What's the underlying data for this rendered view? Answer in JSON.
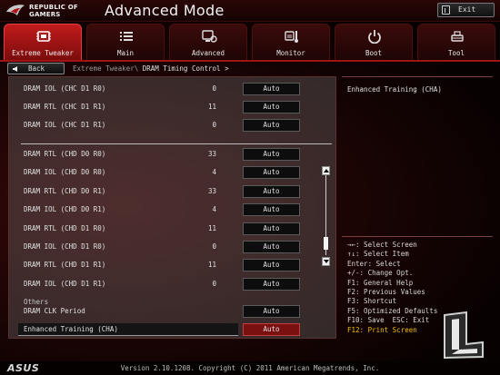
{
  "header": {
    "brand_line1": "REPUBLIC OF",
    "brand_line2": "GAMERS",
    "mode_title": "Advanced Mode",
    "exit_label": "Exit"
  },
  "tabs": [
    {
      "label": "Extreme Tweaker",
      "icon": "chip-icon",
      "active": true
    },
    {
      "label": "Main",
      "icon": "list-icon",
      "active": false
    },
    {
      "label": "Advanced",
      "icon": "advanced-icon",
      "active": false
    },
    {
      "label": "Monitor",
      "icon": "monitor-icon",
      "active": false
    },
    {
      "label": "Boot",
      "icon": "power-icon",
      "active": false
    },
    {
      "label": "Tool",
      "icon": "tool-icon",
      "active": false
    }
  ],
  "breadcrumb": {
    "back_label": "Back",
    "path_parent": "Extreme Tweaker\\",
    "path_current": " DRAM Timing Control >"
  },
  "settings_group1": [
    {
      "label": "DRAM IOL (CHC D1 R0)",
      "value": "0",
      "setting": "Auto"
    },
    {
      "label": "DRAM RTL (CHC D1 R1)",
      "value": "11",
      "setting": "Auto"
    },
    {
      "label": "DRAM IOL (CHC D1 R1)",
      "value": "0",
      "setting": "Auto"
    }
  ],
  "settings_group2": [
    {
      "label": "DRAM RTL (CHD D0 R0)",
      "value": "33",
      "setting": "Auto"
    },
    {
      "label": "DRAM IOL (CHD D0 R0)",
      "value": "4",
      "setting": "Auto"
    },
    {
      "label": "DRAM RTL (CHD D0 R1)",
      "value": "33",
      "setting": "Auto"
    },
    {
      "label": "DRAM IOL (CHD D0 R1)",
      "value": "4",
      "setting": "Auto"
    },
    {
      "label": "DRAM RTL (CHD D1 R0)",
      "value": "11",
      "setting": "Auto"
    },
    {
      "label": "DRAM IOL (CHD D1 R0)",
      "value": "0",
      "setting": "Auto"
    },
    {
      "label": "DRAM RTL (CHD D1 R1)",
      "value": "11",
      "setting": "Auto"
    },
    {
      "label": "DRAM IOL (CHD D1 R1)",
      "value": "0",
      "setting": "Auto"
    }
  ],
  "others": {
    "section_label": "Others",
    "clk_period": {
      "label": "DRAM CLK Period",
      "setting": "Auto"
    },
    "enhanced_training": {
      "label": "Enhanced Training (CHA)",
      "setting": "Auto"
    }
  },
  "help": {
    "title": "Enhanced Training (CHA)",
    "keys": [
      "→←: Select Screen",
      "↑↓: Select Item",
      "Enter: Select",
      "+/-: Change Opt.",
      "F1: General Help",
      "F2: Previous Values",
      "F3: Shortcut",
      "F5: Optimized Defaults",
      "F10: Save  ESC: Exit",
      "F12: Print Screen"
    ]
  },
  "footer": {
    "brand": "ASUS",
    "version": "Version 2.10.1208. Copyright (C) 2011 American Megatrends, Inc."
  },
  "colors": {
    "accent_red": "#c21b1b",
    "key_highlight": "#f0c000"
  }
}
